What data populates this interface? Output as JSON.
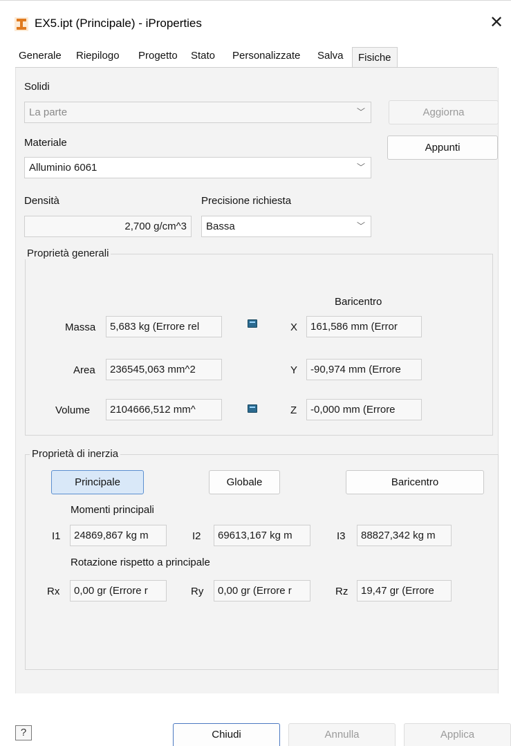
{
  "window": {
    "title": "EX5.ipt (Principale) - iProperties",
    "close_glyph": "✕"
  },
  "tabs": [
    "Generale",
    "Riepilogo",
    "Progetto",
    "Stato",
    "Personalizzate",
    "Salva",
    "Fisiche"
  ],
  "active_tab": "Fisiche",
  "solidi": {
    "label": "Solidi",
    "value": "La parte",
    "aggiorna": "Aggiorna"
  },
  "materiale": {
    "label": "Materiale",
    "value": "Alluminio 6061",
    "appunti": "Appunti"
  },
  "densita": {
    "label": "Densità",
    "value": "2,700 g/cm^3"
  },
  "precisione": {
    "label": "Precisione richiesta",
    "value": "Bassa"
  },
  "generali": {
    "title": "Proprietà generali",
    "baricentro_label": "Baricentro",
    "massa_label": "Massa",
    "massa_value": "5,683 kg (Errore rel",
    "area_label": "Area",
    "area_value": "236545,063 mm^2",
    "volume_label": "Volume",
    "volume_value": "2104666,512 mm^",
    "x_label": "X",
    "x_value": "161,586 mm (Error",
    "y_label": "Y",
    "y_value": "-90,974 mm (Errore",
    "z_label": "Z",
    "z_value": "-0,000 mm (Errore"
  },
  "inerzia": {
    "title": "Proprietà di inerzia",
    "btn_principale": "Principale",
    "btn_globale": "Globale",
    "btn_baricentro": "Baricentro",
    "momenti_label": "Momenti principali",
    "i1_label": "I1",
    "i1_value": "24869,867 kg m",
    "i2_label": "I2",
    "i2_value": "69613,167 kg m",
    "i3_label": "I3",
    "i3_value": "88827,342 kg m",
    "rotazione_label": "Rotazione rispetto a principale",
    "rx_label": "Rx",
    "rx_value": "0,00 gr (Errore r",
    "ry_label": "Ry",
    "ry_value": "0,00 gr (Errore r",
    "rz_label": "Rz",
    "rz_value": "19,47 gr (Errore"
  },
  "footer": {
    "help": "?",
    "chiudi": "Chiudi",
    "annulla": "Annulla",
    "applica": "Applica"
  },
  "icons": {
    "app": "inventor-app-icon",
    "calc": "calculator-icon",
    "chevron": "chevron-down-icon"
  },
  "colors": {
    "accent": "#4a78c0",
    "selected_bg": "#d9e8f8",
    "app_icon": "#e07a1f"
  }
}
